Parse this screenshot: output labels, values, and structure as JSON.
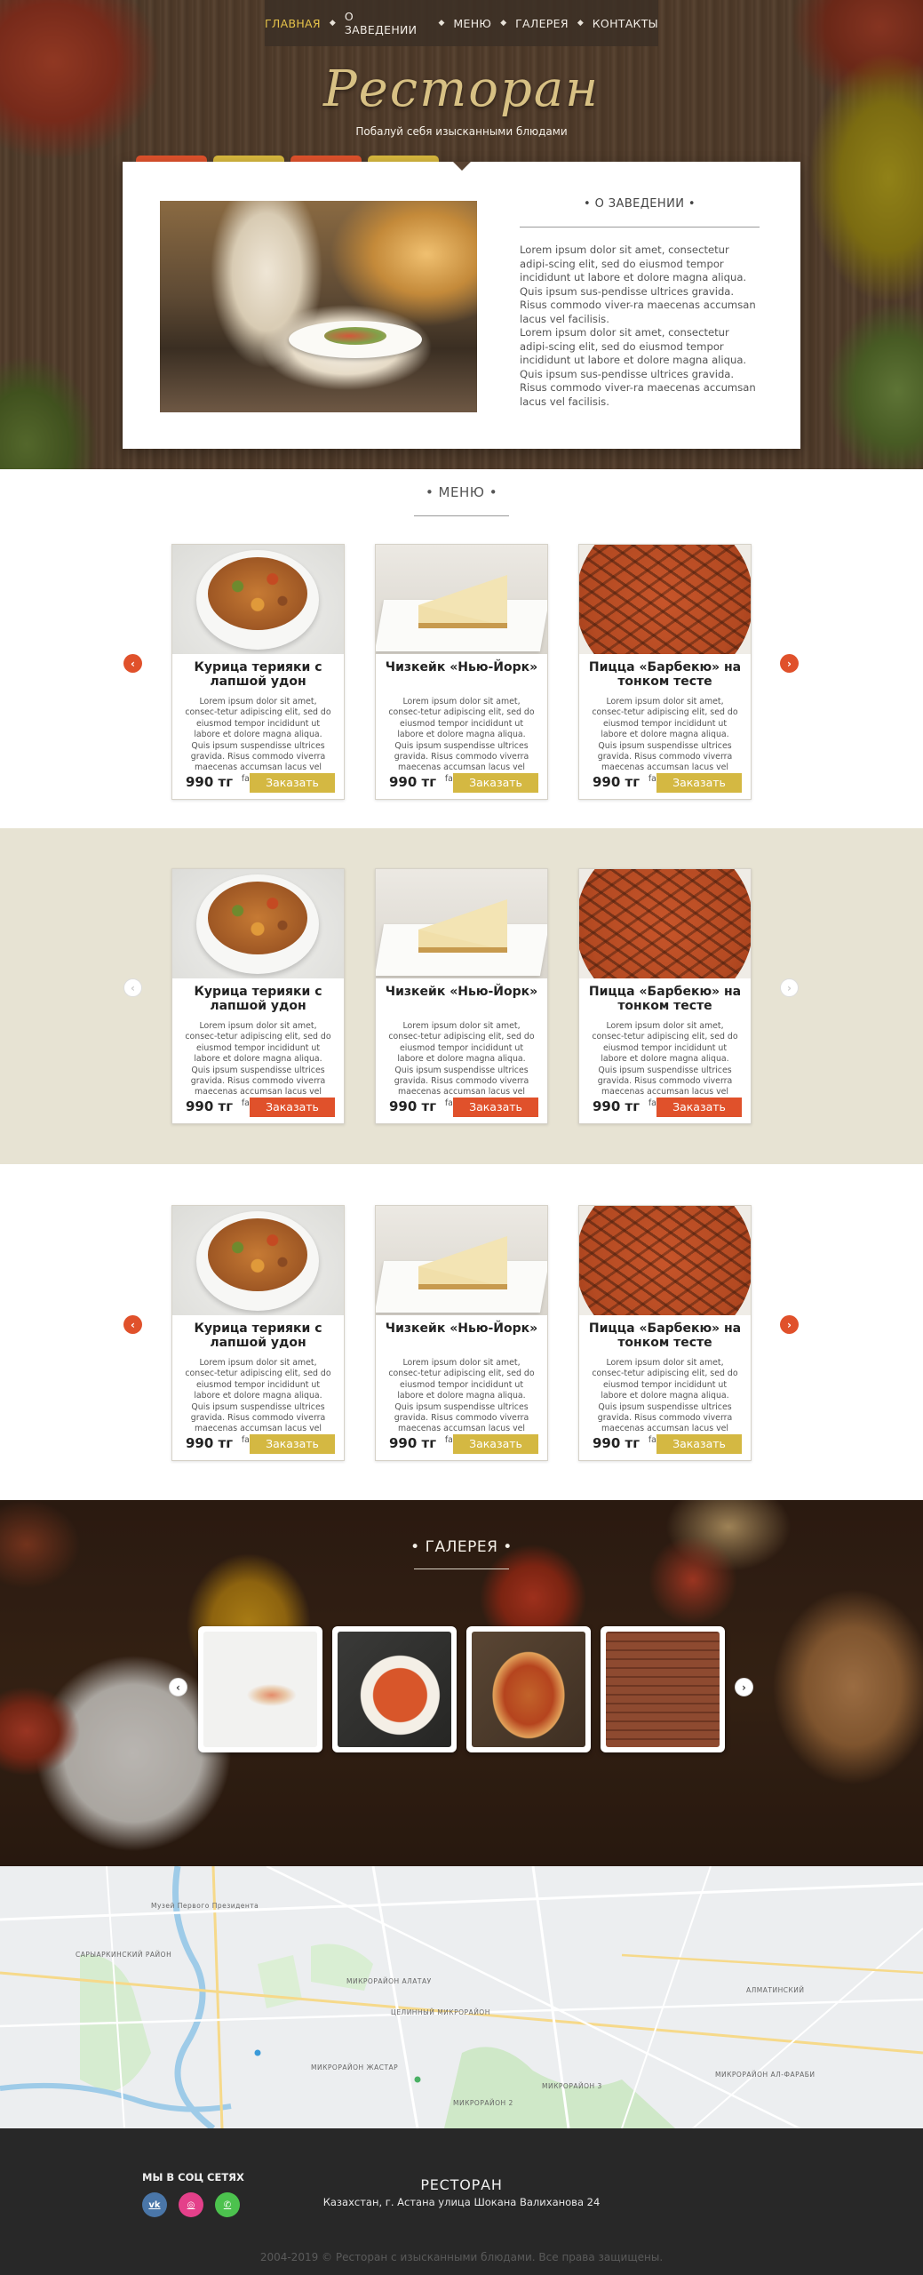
{
  "nav": {
    "items": [
      "ГЛАВНАЯ",
      "О ЗАВЕДЕНИИ",
      "МЕНЮ",
      "ГАЛЕРЕЯ",
      "КОНТАКТЫ"
    ],
    "active": "ГЛАВНАЯ"
  },
  "hero": {
    "title": "Ресторан",
    "subtitle": "Побалуй себя изысканными блюдами"
  },
  "about": {
    "title": "•   О ЗАВЕДЕНИИ   •",
    "paragraphs": [
      "Lorem ipsum dolor sit amet, consectetur adipi-scing elit, sed do eiusmod tempor incididunt ut labore et dolore magna aliqua. Quis ipsum sus-pendisse ultrices gravida. Risus commodo viver-ra maecenas accumsan lacus vel facilisis.",
      "Lorem ipsum dolor sit amet, consectetur adipi-scing elit, sed do eiusmod tempor incididunt ut labore et dolore magna aliqua. Quis ipsum sus-pendisse ultrices gravida. Risus commodo viver-ra maecenas accumsan lacus vel facilisis."
    ]
  },
  "menu": {
    "title": "•   МЕНЮ   •",
    "desc": "Lorem ipsum dolor sit amet, consec-tetur adipiscing elit, sed do eiusmod tempor incididunt ut labore et dolore magna aliqua. Quis ipsum suspendisse ultrices gravida. Risus commodo viverra maecenas accumsan lacus vel facilisis.",
    "order_label": "Заказать",
    "items": [
      {
        "name": "Курица терияки с лапшой удон",
        "price": "990 тг",
        "photo": "noodle"
      },
      {
        "name": "Чизкейк «Нью-Йорк»",
        "price": "990 тг",
        "photo": "cake"
      },
      {
        "name": "Пицца «Барбекю» на тонком тесте",
        "price": "990 тг",
        "photo": "pizza"
      }
    ],
    "rows": [
      {
        "button_color": "#d4b842",
        "arrow_style": "red"
      },
      {
        "button_color": "#e0512b",
        "arrow_style": "white"
      },
      {
        "button_color": "#d4b842",
        "arrow_style": "red"
      }
    ],
    "arrow_left": "‹",
    "arrow_right": "›"
  },
  "gallery": {
    "title": "•   ГАЛЕРЕЯ   •",
    "images": [
      "salmon-dish",
      "tomato-soup",
      "pizza",
      "brick-interior"
    ]
  },
  "footer": {
    "social_title": "МЫ В СОЦ СЕТЯХ",
    "social": [
      {
        "icon": "vk-icon",
        "glyph": "vk"
      },
      {
        "icon": "instagram-icon",
        "glyph": "◎"
      },
      {
        "icon": "whatsapp-icon",
        "glyph": "✆"
      }
    ],
    "title": "РЕСТОРАН",
    "address": "Казахстан, г. Астана улица Шокана Валиханова 24",
    "copyright": "2004-2019 © Ресторан с изысканными блюдами. Все права защищены."
  },
  "colors": {
    "accent_yellow": "#d4b842",
    "accent_red": "#e0512b",
    "beige_band": "#e7e3d3",
    "footer_bg": "#282828"
  }
}
